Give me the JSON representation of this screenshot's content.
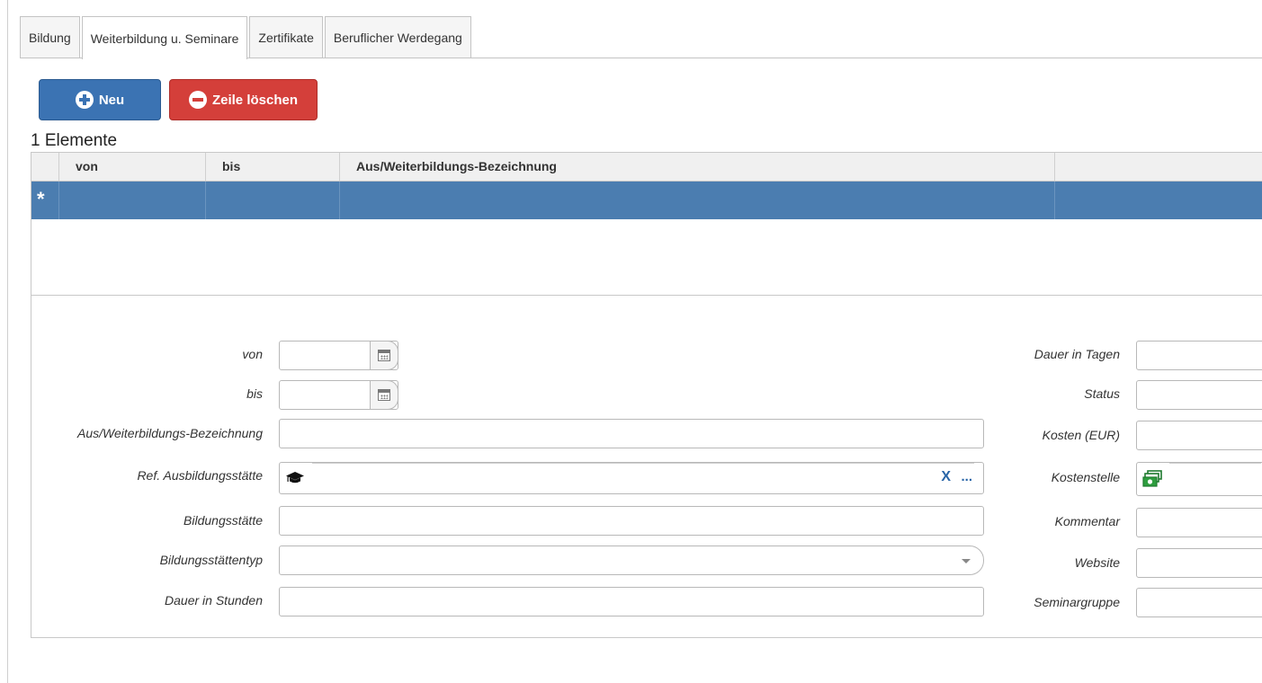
{
  "tabs": [
    "Bildung",
    "Weiterbildung u. Seminare",
    "Zertifikate",
    "Beruflicher Werdegang"
  ],
  "active_tab": "Weiterbildung u. Seminare",
  "toolbar": {
    "new_label": "Neu",
    "delete_label": "Zeile löschen"
  },
  "grid": {
    "count_label": "1 Elemente",
    "columns": [
      "von",
      "bis",
      "Aus/Weiterbildungs-Bezeichnung",
      ""
    ],
    "new_row_marker": "*",
    "selected_row_color": "#4b7db0"
  },
  "form": {
    "left": {
      "von": {
        "label": "von",
        "value": ""
      },
      "bis": {
        "label": "bis",
        "value": ""
      },
      "bezeichnung": {
        "label": "Aus/Weiterbildungs-Bezeichnung",
        "value": ""
      },
      "ref_ausbildungsstaette": {
        "label": "Ref. Ausbildungsstätte",
        "value": "",
        "clear_label": "X",
        "browse_label": "...",
        "icon": "graduation-cap-icon"
      },
      "bildungsstaette": {
        "label": "Bildungsstätte",
        "value": ""
      },
      "bildungsstaettentyp": {
        "label": "Bildungsstättentyp",
        "value": ""
      },
      "dauer_stunden": {
        "label": "Dauer in Stunden",
        "value": ""
      }
    },
    "right": {
      "dauer_tage": {
        "label": "Dauer in Tagen",
        "value": ""
      },
      "status": {
        "label": "Status",
        "value": ""
      },
      "kosten": {
        "label": "Kosten (EUR)",
        "value": ""
      },
      "kostenstelle": {
        "label": "Kostenstelle",
        "value": "",
        "icon": "money-icon"
      },
      "kommentar": {
        "label": "Kommentar",
        "value": ""
      },
      "website": {
        "label": "Website",
        "value": ""
      },
      "seminargruppe": {
        "label": "Seminargruppe",
        "value": ""
      }
    }
  },
  "colors": {
    "primary": "#3b73b3",
    "danger": "#d43f3a",
    "link": "#2a66a8"
  }
}
